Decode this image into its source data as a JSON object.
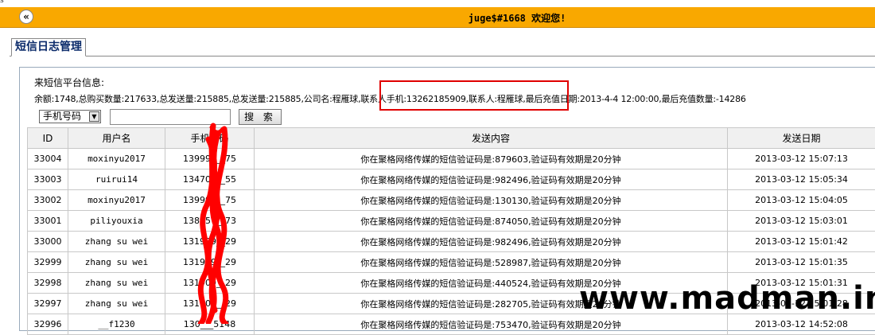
{
  "corner_mark": "s",
  "header": {
    "back_icon": "double-chevron-left-icon",
    "back_glyph": "«",
    "welcome_text": "juge$#1668 欢迎您!",
    "bar_color": "#f9a800"
  },
  "tab": {
    "label": "短信日志管理"
  },
  "info": {
    "title": "来短信平台信息:",
    "line": "余额:1748,总购买数量:217633,总发送量:215885,总发送量:215885,公司名:程雁球,联系人手机:13262185909,联系人:程雁球,最后充值日期:2013-4-4 12:00:00,最后充值数量:-14286"
  },
  "search": {
    "field_select": "手机号码",
    "input_value": "",
    "button_label": "搜 索"
  },
  "table": {
    "columns": [
      "ID",
      "用户名",
      "手机号码",
      "发送内容",
      "发送日期"
    ],
    "rows": [
      [
        "33004",
        "moxinyu2017",
        "139997__75",
        "你在聚格网络传媒的短信验证码是:879603,验证码有效期是20分钟",
        "2013-03-12 15:07:13"
      ],
      [
        "33003",
        "ruirui14",
        "134700__55",
        "你在聚格网络传媒的短信验证码是:982496,验证码有效期是20分钟",
        "2013-03-12 15:05:34"
      ],
      [
        "33002",
        "moxinyu2017",
        "139997__75",
        "你在聚格网络传媒的短信验证码是:130130,验证码有效期是20分钟",
        "2013-03-12 15:04:05"
      ],
      [
        "33001",
        "piliyouxia",
        "138457__73",
        "你在聚格网络传媒的短信验证码是:874050,验证码有效期是20分钟",
        "2013-03-12 15:03:01"
      ],
      [
        "33000",
        "zhang su wei",
        "131909__29",
        "你在聚格网络传媒的短信验证码是:982496,验证码有效期是20分钟",
        "2013-03-12 15:01:42"
      ],
      [
        "32999",
        "zhang su wei",
        "131909__29",
        "你在聚格网络传媒的短信验证码是:528987,验证码有效期是20分钟",
        "2013-03-12 15:01:35"
      ],
      [
        "32998",
        "zhang su wei",
        "131909__29",
        "你在聚格网络传媒的短信验证码是:440524,验证码有效期是20分钟",
        "2013-03-12 15:01:31"
      ],
      [
        "32997",
        "zhang su wei",
        "131909__29",
        "你在聚格网络传媒的短信验证码是:282705,验证码有效期是20分钟",
        "2013-03-12 15:01:28"
      ],
      [
        "32996",
        "__f1230",
        "130___5148",
        "你在聚格网络传媒的短信验证码是:753470,验证码有效期是20分钟",
        "2013-03-12 14:52:08"
      ]
    ]
  },
  "watermark": "www.madman.in",
  "colors": {
    "highlight_box": "#e00000",
    "scribble": "#ff0000"
  }
}
